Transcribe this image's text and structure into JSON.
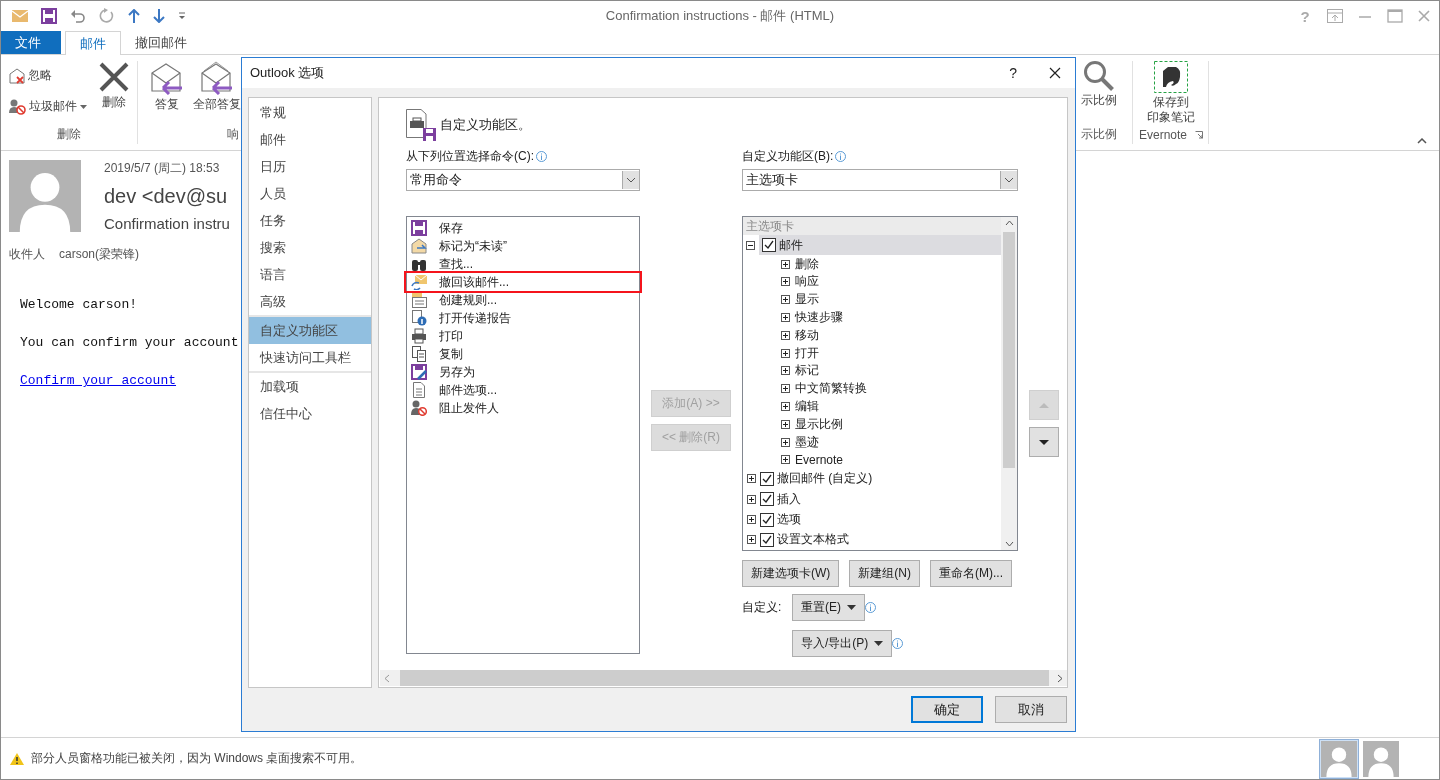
{
  "window": {
    "title": "Confirmation instructions - 邮件 (HTML)",
    "help": "?"
  },
  "ribbon_tabs": [
    {
      "label": "文件",
      "kind": "file",
      "selected": false
    },
    {
      "label": "邮件",
      "kind": "tab",
      "selected": true
    },
    {
      "label": "撤回邮件",
      "kind": "tab",
      "selected": false
    }
  ],
  "ribbon": {
    "delete_group": {
      "small_buttons": [
        "忽略",
        "垃圾邮件"
      ],
      "large_button": "删除",
      "label": "删除"
    },
    "respond_group": {
      "buttons": [
        "答复",
        "全部答复"
      ],
      "label": "响"
    },
    "zoom_group": {
      "button": "示比例",
      "label": "示比例"
    },
    "evernote_group": {
      "button_lines": [
        "保存到",
        "印象笔记"
      ],
      "label": "Evernote"
    }
  },
  "mail": {
    "date": "2019/5/7 (周二) 18:53",
    "sender": "dev <dev@su",
    "subject": "Confirmation instru",
    "to_label": "收件人",
    "to": "carson(梁荣锋)",
    "body": [
      "Welcome carson!",
      "You can confirm your account"
    ],
    "link": "Confirm your account"
  },
  "status_bar": {
    "message": "部分人员窗格功能已被关闭，因为 Windows 桌面搜索不可用。",
    "people": [
      {
        "selected": true
      },
      {
        "selected": false
      }
    ]
  },
  "dialog": {
    "title": "Outlook 选项",
    "help": "?",
    "nav_groups": [
      [
        {
          "label": "常规",
          "selected": false
        },
        {
          "label": "邮件",
          "selected": false
        },
        {
          "label": "日历",
          "selected": false
        },
        {
          "label": "人员",
          "selected": false
        },
        {
          "label": "任务",
          "selected": false
        },
        {
          "label": "搜索",
          "selected": false
        },
        {
          "label": "语言",
          "selected": false
        },
        {
          "label": "高级",
          "selected": false
        }
      ],
      [
        {
          "label": "自定义功能区",
          "selected": true
        },
        {
          "label": "快速访问工具栏",
          "selected": false
        }
      ],
      [
        {
          "label": "加载项",
          "selected": false
        },
        {
          "label": "信任中心",
          "selected": false
        }
      ]
    ],
    "heading": "自定义功能区。",
    "commands": {
      "label": "从下列位置选择命令(C):",
      "dropdown": "常用命令",
      "items": [
        {
          "label": "保存",
          "highlighted": false
        },
        {
          "label": "标记为“未读”",
          "highlighted": false
        },
        {
          "label": "查找...",
          "highlighted": false
        },
        {
          "label": "撤回该邮件...",
          "highlighted": true
        },
        {
          "label": "创建规则...",
          "highlighted": false
        },
        {
          "label": "打开传递报告",
          "highlighted": false
        },
        {
          "label": "打印",
          "highlighted": false
        },
        {
          "label": "复制",
          "highlighted": false
        },
        {
          "label": "另存为",
          "highlighted": false
        },
        {
          "label": "邮件选项...",
          "highlighted": false
        },
        {
          "label": "阻止发件人",
          "highlighted": false
        }
      ]
    },
    "transfer_buttons": [
      {
        "label": "添加(A) >>",
        "disabled": true
      },
      {
        "label": "<< 删除(R)",
        "disabled": true
      }
    ],
    "ribbon_tree": {
      "label": "自定义功能区(B):",
      "dropdown": "主选项卡",
      "header": "主选项卡",
      "nodes": [
        {
          "label": "邮件",
          "checked": true,
          "expanded": true,
          "selected": true,
          "children": [
            {
              "label": "删除",
              "expanded": false,
              "selected": false
            },
            {
              "label": "响应",
              "expanded": false,
              "selected": false
            },
            {
              "label": "显示",
              "expanded": false,
              "selected": false
            },
            {
              "label": "快速步骤",
              "expanded": false,
              "selected": false
            },
            {
              "label": "移动",
              "expanded": false,
              "selected": false
            },
            {
              "label": "打开",
              "expanded": false,
              "selected": false
            },
            {
              "label": "标记",
              "expanded": false,
              "selected": false
            },
            {
              "label": "中文简繁转换",
              "expanded": false,
              "selected": false
            },
            {
              "label": "编辑",
              "expanded": false,
              "selected": false
            },
            {
              "label": "显示比例",
              "expanded": false,
              "selected": false
            },
            {
              "label": "墨迹",
              "expanded": false,
              "selected": false
            },
            {
              "label": "Evernote",
              "expanded": false,
              "selected": false
            }
          ]
        },
        {
          "label": "撤回邮件 (自定义)",
          "checked": true,
          "expanded": false,
          "selected": false
        },
        {
          "label": "插入",
          "checked": true,
          "expanded": false,
          "selected": false
        },
        {
          "label": "选项",
          "checked": true,
          "expanded": false,
          "selected": false
        },
        {
          "label": "设置文本格式",
          "checked": true,
          "expanded": false,
          "selected": false
        }
      ]
    },
    "move_buttons": [
      {
        "kind": "up",
        "disabled": true
      },
      {
        "kind": "down",
        "disabled": false
      }
    ],
    "tree_buttons": [
      "新建选项卡(W)",
      "新建组(N)",
      "重命名(M)..."
    ],
    "customize_label": "自定义:",
    "reset_button": "重置(E)",
    "import_export_button": "导入/导出(P)",
    "footer_buttons": [
      {
        "label": "确定",
        "kind": "default"
      },
      {
        "label": "取消",
        "kind": "normal"
      }
    ]
  }
}
